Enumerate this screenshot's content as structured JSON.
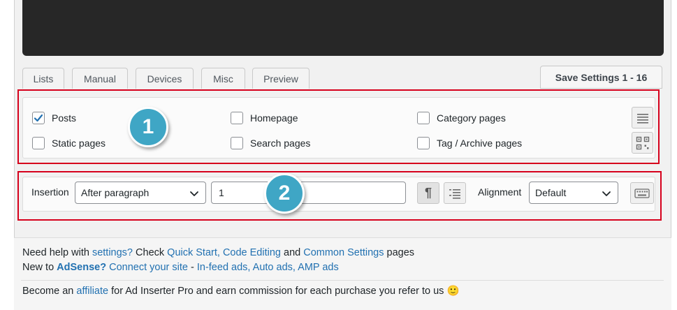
{
  "tabs": [
    "Lists",
    "Manual",
    "Devices",
    "Misc",
    "Preview"
  ],
  "save_button": "Save Settings 1 - 16",
  "checkboxes": [
    {
      "label": "Posts",
      "checked": true
    },
    {
      "label": "Static pages",
      "checked": false
    },
    {
      "label": "Homepage",
      "checked": false
    },
    {
      "label": "Search pages",
      "checked": false
    },
    {
      "label": "Category pages",
      "checked": false
    },
    {
      "label": "Tag / Archive pages",
      "checked": false
    }
  ],
  "badges": [
    "1",
    "2"
  ],
  "insertion": {
    "label": "Insertion",
    "selected": "After paragraph",
    "value": "1"
  },
  "alignment": {
    "label": "Alignment",
    "selected": "Default"
  },
  "help": {
    "line1": {
      "a": "Need help with ",
      "settings": "settings?",
      "b": " Check ",
      "quick_start": "Quick Start, Code Editing",
      "c": " and ",
      "common": "Common Settings",
      "d": " pages"
    },
    "line2": {
      "a": "New to ",
      "adsense": "AdSense?",
      "connect": "Connect your site",
      "dash": " - ",
      "formats": "In-feed ads, Auto ads, AMP ads"
    },
    "line3": {
      "a": "Become an ",
      "affiliate": "affiliate",
      "b": " for Ad Inserter Pro and earn commission for each purchase you refer to us ",
      "emoji": "🙂"
    }
  },
  "colors": {
    "accent_red": "#d6001c",
    "badge_blue": "#3fa6c5",
    "link_blue": "#2271b1"
  }
}
